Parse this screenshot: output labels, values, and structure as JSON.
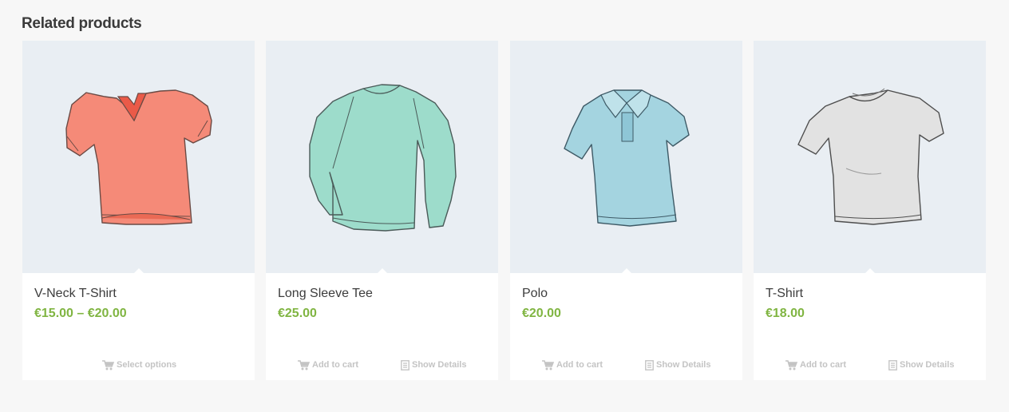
{
  "section": {
    "heading": "Related products"
  },
  "products": [
    {
      "title": "V-Neck T-Shirt",
      "price": "€15.00 – €20.00",
      "image": "v-neck-tshirt-image",
      "actions": [
        {
          "label": "Select options",
          "icon": "cart-icon"
        }
      ]
    },
    {
      "title": "Long Sleeve Tee",
      "price": "€25.00",
      "image": "long-sleeve-tee-image",
      "actions": [
        {
          "label": "Add to cart",
          "icon": "cart-icon"
        },
        {
          "label": "Show Details",
          "icon": "document-icon"
        }
      ]
    },
    {
      "title": "Polo",
      "price": "€20.00",
      "image": "polo-image",
      "actions": [
        {
          "label": "Add to cart",
          "icon": "cart-icon"
        },
        {
          "label": "Show Details",
          "icon": "document-icon"
        }
      ]
    },
    {
      "title": "T-Shirt",
      "price": "€18.00",
      "image": "tshirt-image",
      "actions": [
        {
          "label": "Add to cart",
          "icon": "cart-icon"
        },
        {
          "label": "Show Details",
          "icon": "document-icon"
        }
      ]
    }
  ],
  "colors": {
    "price": "#80b542",
    "image_bg": "#e9eef3",
    "action_text": "#c4c4c4"
  }
}
